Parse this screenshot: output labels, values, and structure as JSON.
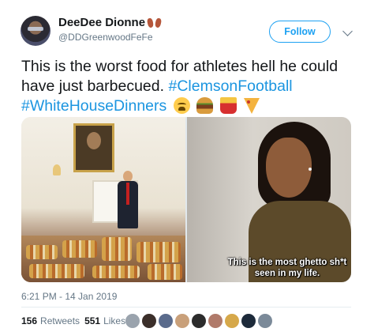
{
  "user": {
    "display_name": "DeeDee Dionne",
    "name_emoji": "feet-emoji",
    "handle": "@DDGreenwoodFeFe"
  },
  "follow_button": {
    "label": "Follow"
  },
  "tweet": {
    "text_plain": "This is the worst food for athletes hell he could have just barbecued.",
    "hashtags": [
      "#ClemsonFootball",
      "#WhiteHouseDinners"
    ],
    "emojis": [
      "weary-face-emoji",
      "hamburger-emoji",
      "fries-emoji",
      "pizza-emoji"
    ]
  },
  "media": {
    "right_photo_caption": "This is the most ghetto sh*t seen in my life."
  },
  "timestamp": "6:21 PM - 14 Jan 2019",
  "stats": {
    "retweets_count": "156",
    "retweets_label": "Retweets",
    "likes_count": "551",
    "likes_label": "Likes"
  },
  "colors": {
    "link": "#1b95e0",
    "follow_border": "#1da1f2",
    "meta_text": "#657786"
  },
  "liker_avatar_colors": [
    "#9aa3ad",
    "#3b2f2a",
    "#5a6b8c",
    "#c9a07a",
    "#2c2c2c",
    "#b07a6a",
    "#d6a84a",
    "#1d2a3a",
    "#7b8a99"
  ]
}
